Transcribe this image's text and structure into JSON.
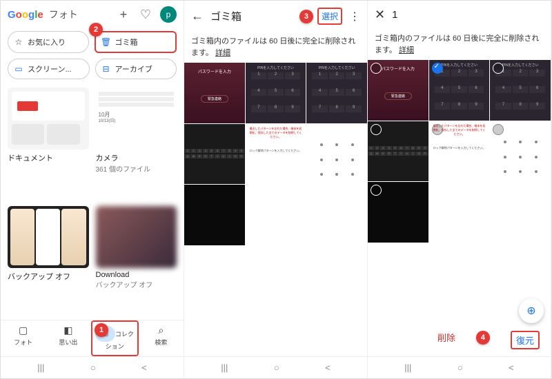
{
  "panel1": {
    "app_name": "フォト",
    "avatar_letter": "p",
    "chips": [
      {
        "icon": "☆",
        "label": "お気に入り"
      },
      {
        "icon": "🗑",
        "label": "ゴミ箱"
      },
      {
        "icon": "▭",
        "label": "スクリーン..."
      },
      {
        "icon": "⊟",
        "label": "アーカイブ"
      }
    ],
    "albums": [
      {
        "title": "ドキュメント",
        "sub": ""
      },
      {
        "title": "カメラ",
        "sub": "361 個のファイル",
        "extra": "10月",
        "extra2": "10/13(日)"
      },
      {
        "title": "バックアップ オフ",
        "sub": ""
      },
      {
        "title": "Download",
        "sub": "バックアップ オフ"
      }
    ],
    "nav": [
      {
        "label": "フォト"
      },
      {
        "label": "思い出"
      },
      {
        "label": "コレクション"
      },
      {
        "label": "検索"
      }
    ]
  },
  "panel2": {
    "title": "ゴミ箱",
    "select_label": "選択",
    "info_text": "ゴミ箱内のファイルは 60 日後に完全に削除されます。",
    "detail_label": "詳細"
  },
  "panel3": {
    "count": "1",
    "info_text": "ゴミ箱内のファイルは 60 日後に完全に削除されます。",
    "detail_label": "詳細",
    "delete_label": "削除",
    "restore_label": "復元"
  },
  "callouts": {
    "c1": "1",
    "c2": "2",
    "c3": "3",
    "c4": "4"
  },
  "thumb_labels": {
    "password": "パスワードを入力",
    "pin": "PINを入力してください",
    "emergency": "緊急連絡",
    "pattern_red": "最近したパターンを忘れた場合、端末を初期化、保存した全てのデータを削除してください。",
    "pattern_prompt": "ロック解除パターンを入力してください。"
  }
}
